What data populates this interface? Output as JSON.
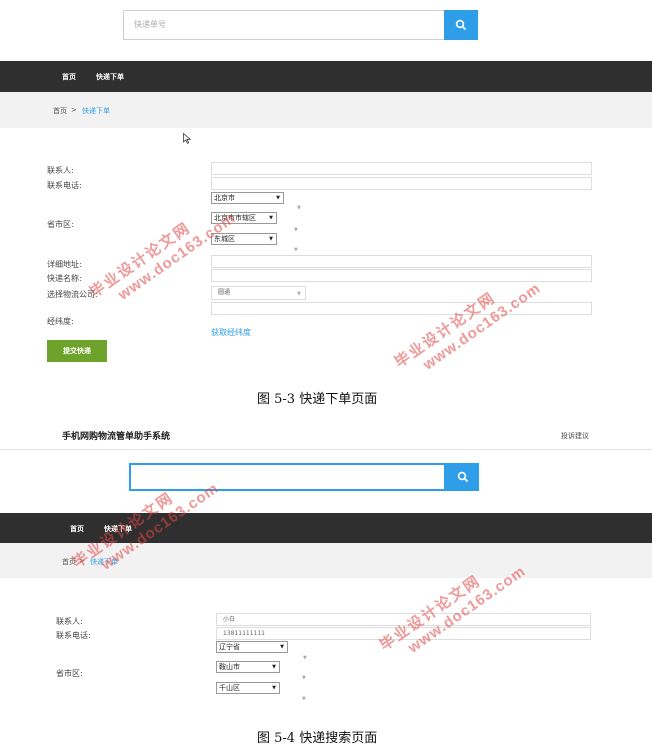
{
  "figure1": {
    "search": {
      "placeholder": "快递单号"
    },
    "nav": {
      "items": [
        "首页",
        "快递下单"
      ]
    },
    "breadcrumb": {
      "home": "首页",
      "separator": ">",
      "current": "快递下单"
    },
    "form": {
      "contact_label": "联系人:",
      "phone_label": "联系电话:",
      "region_label": "省市区:",
      "province_value": "北京市",
      "city_value": "北京市市辖区",
      "district_value": "东城区",
      "address_label": "详细地址:",
      "express_name_label": "快递名称:",
      "company_label": "选择物流公司:",
      "company_value": "圆通",
      "coords_label": "经纬度:",
      "get_coords_link": "获取经纬度",
      "submit_label": "提交快递"
    },
    "caption": "图 5-3 快递下单页面"
  },
  "figure2": {
    "app_title": "手机网购物流管单助手系统",
    "feedback_link": "投诉建议",
    "nav": {
      "items": [
        "首页",
        "快递下单"
      ]
    },
    "breadcrumb": {
      "home": "首页",
      "separator": ">",
      "current": "快递下单"
    },
    "form": {
      "contact_label": "联系人:",
      "contact_value": "小白",
      "phone_label": "联系电话:",
      "phone_value": "13811111111",
      "region_label": "省市区:",
      "province_value": "辽宁省",
      "city_value": "鞍山市",
      "district_value": "千山区"
    },
    "caption": "图 5-4 快递搜索页面"
  },
  "watermark": {
    "line1": "毕业设计论文网",
    "line2": "www.doc163.com"
  },
  "icons": {
    "search": "search-icon",
    "cursor": "mouse-pointer-icon"
  },
  "colors": {
    "accent": "#2f9ee8",
    "nav_bg": "#2f2f2f",
    "submit": "#6ea32b",
    "watermark": "#e24646"
  }
}
